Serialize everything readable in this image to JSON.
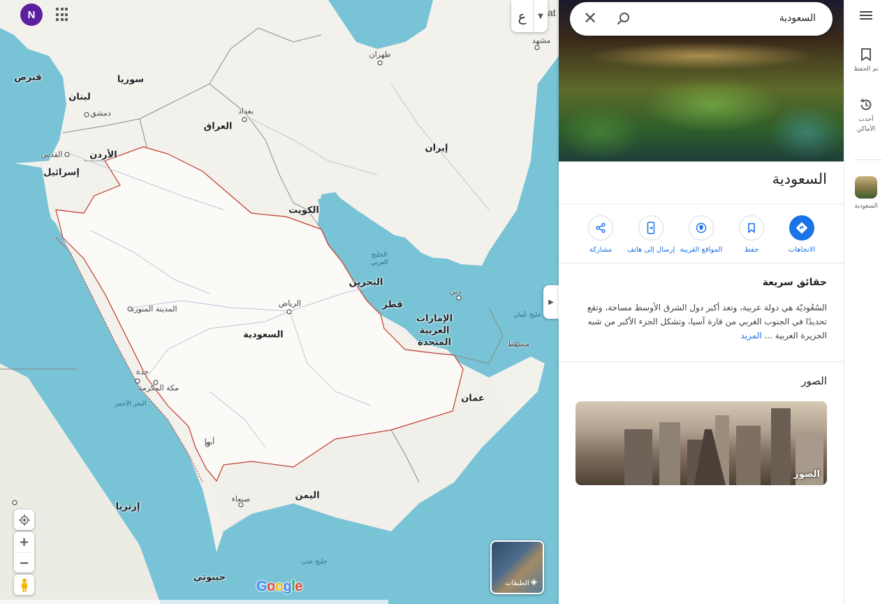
{
  "map": {
    "lang_button": "ع",
    "corner_label": "at",
    "layers_label": "الطبقات",
    "logo": "Google",
    "countries": [
      {
        "id": "cyprus",
        "label": "قبرص"
      },
      {
        "id": "syria",
        "label": "سوريا"
      },
      {
        "id": "lebanon",
        "label": "لبنان"
      },
      {
        "id": "iraq",
        "label": "العراق"
      },
      {
        "id": "jordan",
        "label": "الأردن"
      },
      {
        "id": "israel",
        "label": "إسرائيل"
      },
      {
        "id": "iran",
        "label": "إيران"
      },
      {
        "id": "kuwait",
        "label": "الكويت"
      },
      {
        "id": "bahrain",
        "label": "البحرين"
      },
      {
        "id": "qatar",
        "label": "قطر"
      },
      {
        "id": "uae",
        "label": "الإمارات العربية المتحدة"
      },
      {
        "id": "saudi",
        "label": "السعودية"
      },
      {
        "id": "oman",
        "label": "عمان"
      },
      {
        "id": "yemen",
        "label": "اليمن"
      },
      {
        "id": "eritrea",
        "label": "إرتريا"
      },
      {
        "id": "djibouti",
        "label": "جيبوتي"
      }
    ],
    "cities": [
      {
        "id": "mashhad",
        "label": "مشهد"
      },
      {
        "id": "tehran",
        "label": "طهران"
      },
      {
        "id": "damascus",
        "label": "دمشق"
      },
      {
        "id": "baghdad",
        "label": "بغداد"
      },
      {
        "id": "jerusalem",
        "label": "القدس"
      },
      {
        "id": "riyadh",
        "label": "الرياض"
      },
      {
        "id": "medina",
        "label": "المدينة المنورة"
      },
      {
        "id": "jeddah",
        "label": "جدة"
      },
      {
        "id": "mecca",
        "label": "مكة المكرمة"
      },
      {
        "id": "abha",
        "label": "أبها"
      },
      {
        "id": "dubai",
        "label": "دبي"
      },
      {
        "id": "muscat",
        "label": "مسقط"
      },
      {
        "id": "sanaa",
        "label": "صنعاء"
      }
    ],
    "waters": [
      {
        "id": "gulf",
        "label": "الخليج العربي"
      },
      {
        "id": "oman-gulf",
        "label": "خليج عُمان"
      },
      {
        "id": "red-sea",
        "label": "البحر الأحمر"
      },
      {
        "id": "aden",
        "label": "خليج عدن"
      }
    ]
  },
  "panel": {
    "search_query": "السعودية",
    "title": "السعودية",
    "actions": [
      {
        "id": "directions",
        "label": "الاتجاهات"
      },
      {
        "id": "save",
        "label": "حفظ"
      },
      {
        "id": "nearby",
        "label": "المواقع القريبة"
      },
      {
        "id": "send",
        "label": "إرسال إلى هاتف"
      },
      {
        "id": "share",
        "label": "مشاركة"
      }
    ],
    "quick_facts": {
      "heading": "حقائق سريعة",
      "text": "السُعُوديّة هي دولة عربية، وتعد أكبر دول الشرق الأوسط مساحة، وتقع تحديدًا في الجنوب الغربي من قارة آسيا، وتشكل الجزء الأكبر من شبه الجزيرة العربية ...",
      "more": "المزيد"
    },
    "photos": {
      "heading": "الصور",
      "label": "الصور"
    }
  },
  "rail": {
    "saved": "تم الحفظ",
    "recents": "أحدث الأماكن",
    "recent_place": "السعودية"
  },
  "avatar_letter": "N"
}
